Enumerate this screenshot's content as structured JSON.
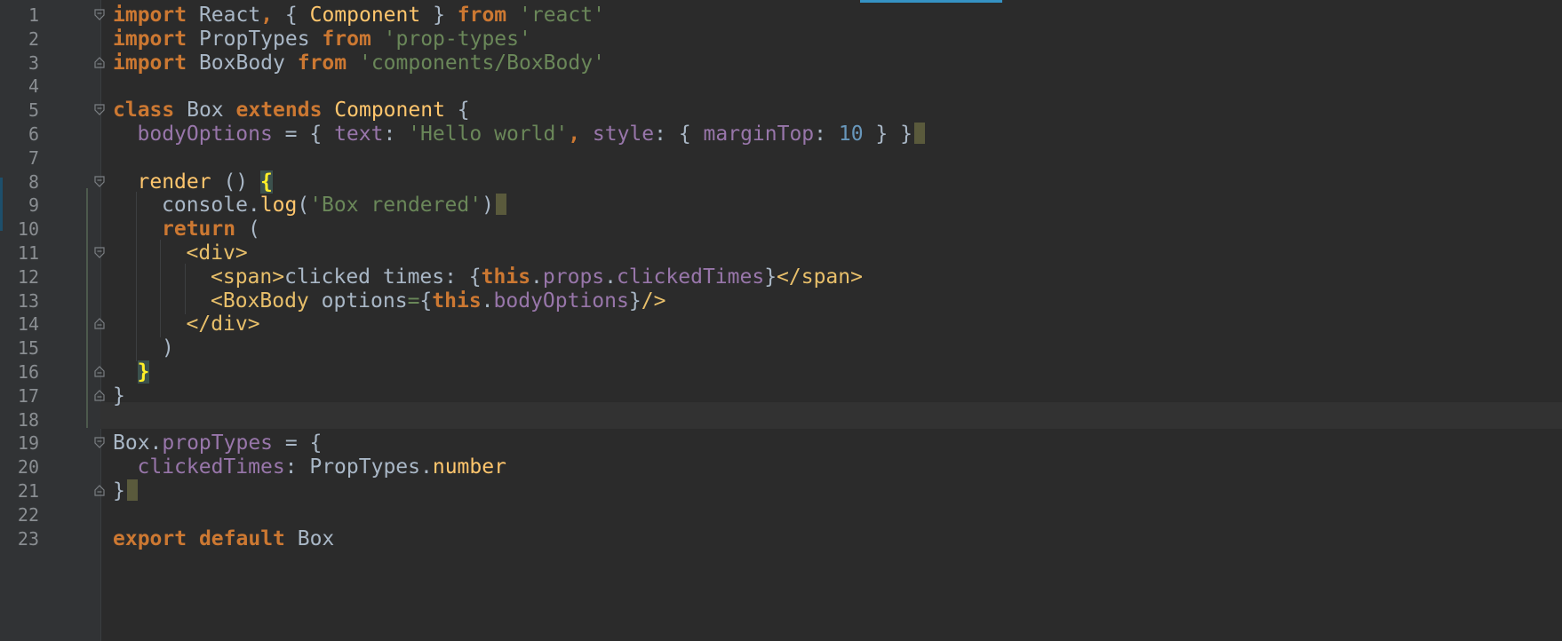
{
  "editor": {
    "lines": [
      {
        "n": "1",
        "fold": "open",
        "indent": 0,
        "tokens": [
          {
            "t": "import",
            "c": "kw"
          },
          {
            "t": " React",
            "c": "plain"
          },
          {
            "t": ",",
            "c": "kw"
          },
          {
            "t": " { ",
            "c": "plain"
          },
          {
            "t": "Component",
            "c": "cls"
          },
          {
            "t": " } ",
            "c": "plain"
          },
          {
            "t": "from",
            "c": "kw"
          },
          {
            "t": " ",
            "c": "plain"
          },
          {
            "t": "'react'",
            "c": "str"
          }
        ]
      },
      {
        "n": "2",
        "fold": "",
        "indent": 0,
        "tokens": [
          {
            "t": "import",
            "c": "kw"
          },
          {
            "t": " PropTypes ",
            "c": "plain"
          },
          {
            "t": "from",
            "c": "kw"
          },
          {
            "t": " ",
            "c": "plain"
          },
          {
            "t": "'prop-types'",
            "c": "str"
          }
        ]
      },
      {
        "n": "3",
        "fold": "close",
        "indent": 0,
        "tokens": [
          {
            "t": "import",
            "c": "kw"
          },
          {
            "t": " BoxBody ",
            "c": "plain"
          },
          {
            "t": "from",
            "c": "kw"
          },
          {
            "t": " ",
            "c": "plain"
          },
          {
            "t": "'components/BoxBody'",
            "c": "str"
          }
        ]
      },
      {
        "n": "4",
        "fold": "",
        "indent": 0,
        "tokens": []
      },
      {
        "n": "5",
        "fold": "open",
        "indent": 0,
        "tokens": [
          {
            "t": "class",
            "c": "kw"
          },
          {
            "t": " Box ",
            "c": "plain"
          },
          {
            "t": "extends",
            "c": "kw"
          },
          {
            "t": " ",
            "c": "plain"
          },
          {
            "t": "Component",
            "c": "cls"
          },
          {
            "t": " {",
            "c": "plain"
          }
        ]
      },
      {
        "n": "6",
        "fold": "",
        "indent": 1,
        "eol": true,
        "tokens": [
          {
            "t": "bodyOptions",
            "c": "prop"
          },
          {
            "t": " = { ",
            "c": "plain"
          },
          {
            "t": "text",
            "c": "prop"
          },
          {
            "t": ": ",
            "c": "plain"
          },
          {
            "t": "'Hello world'",
            "c": "str"
          },
          {
            "t": ", ",
            "c": "kw"
          },
          {
            "t": "style",
            "c": "prop"
          },
          {
            "t": ": { ",
            "c": "plain"
          },
          {
            "t": "marginTop",
            "c": "prop"
          },
          {
            "t": ": ",
            "c": "plain"
          },
          {
            "t": "10",
            "c": "num"
          },
          {
            "t": " } }",
            "c": "plain"
          }
        ]
      },
      {
        "n": "7",
        "fold": "",
        "indent": 0,
        "tokens": []
      },
      {
        "n": "8",
        "fold": "open",
        "indent": 1,
        "tokens": [
          {
            "t": "render",
            "c": "cls"
          },
          {
            "t": " () ",
            "c": "plain"
          },
          {
            "t": "{",
            "c": "brace-hl"
          }
        ]
      },
      {
        "n": "9",
        "fold": "",
        "indent": 2,
        "eol": true,
        "tokens": [
          {
            "t": "console.",
            "c": "plain"
          },
          {
            "t": "log",
            "c": "cls"
          },
          {
            "t": "(",
            "c": "plain"
          },
          {
            "t": "'Box rendered'",
            "c": "str"
          },
          {
            "t": ")",
            "c": "plain"
          }
        ]
      },
      {
        "n": "10",
        "fold": "",
        "indent": 2,
        "tokens": [
          {
            "t": "return",
            "c": "kw"
          },
          {
            "t": " (",
            "c": "plain"
          }
        ]
      },
      {
        "n": "11",
        "fold": "open",
        "indent": 3,
        "tokens": [
          {
            "t": "<div>",
            "c": "tag"
          }
        ]
      },
      {
        "n": "12",
        "fold": "",
        "indent": 4,
        "tokens": [
          {
            "t": "<span>",
            "c": "tag"
          },
          {
            "t": "clicked times: {",
            "c": "plain"
          },
          {
            "t": "this",
            "c": "kw"
          },
          {
            "t": ".",
            "c": "plain"
          },
          {
            "t": "props",
            "c": "prop"
          },
          {
            "t": ".",
            "c": "plain"
          },
          {
            "t": "clickedTimes",
            "c": "prop"
          },
          {
            "t": "}",
            "c": "plain"
          },
          {
            "t": "</span>",
            "c": "tag"
          }
        ]
      },
      {
        "n": "13",
        "fold": "",
        "indent": 4,
        "tokens": [
          {
            "t": "<BoxBody",
            "c": "tag"
          },
          {
            "t": " options",
            "c": "plain"
          },
          {
            "t": "=",
            "c": "str"
          },
          {
            "t": "{",
            "c": "plain"
          },
          {
            "t": "this",
            "c": "kw"
          },
          {
            "t": ".",
            "c": "plain"
          },
          {
            "t": "bodyOptions",
            "c": "prop"
          },
          {
            "t": "}",
            "c": "plain"
          },
          {
            "t": "/>",
            "c": "tag"
          }
        ]
      },
      {
        "n": "14",
        "fold": "close",
        "indent": 3,
        "tokens": [
          {
            "t": "</div>",
            "c": "tag"
          }
        ]
      },
      {
        "n": "15",
        "fold": "",
        "indent": 2,
        "tokens": [
          {
            "t": ")",
            "c": "plain"
          }
        ]
      },
      {
        "n": "16",
        "fold": "close",
        "indent": 1,
        "tokens": [
          {
            "t": "}",
            "c": "brace-hl"
          }
        ]
      },
      {
        "n": "17",
        "fold": "close",
        "indent": 0,
        "tokens": [
          {
            "t": "}",
            "c": "plain"
          }
        ]
      },
      {
        "n": "18",
        "fold": "",
        "indent": 0,
        "tokens": []
      },
      {
        "n": "19",
        "fold": "open",
        "indent": 0,
        "tokens": [
          {
            "t": "Box.",
            "c": "plain"
          },
          {
            "t": "propTypes",
            "c": "prop"
          },
          {
            "t": " = {",
            "c": "plain"
          }
        ]
      },
      {
        "n": "20",
        "fold": "",
        "indent": 1,
        "tokens": [
          {
            "t": "clickedTimes",
            "c": "prop"
          },
          {
            "t": ": PropTypes.",
            "c": "plain"
          },
          {
            "t": "number",
            "c": "cls"
          }
        ]
      },
      {
        "n": "21",
        "fold": "close",
        "indent": 0,
        "eol": true,
        "tokens": [
          {
            "t": "}",
            "c": "plain"
          }
        ]
      },
      {
        "n": "22",
        "fold": "",
        "indent": 0,
        "tokens": []
      },
      {
        "n": "23",
        "fold": "",
        "indent": 0,
        "tokens": [
          {
            "t": "export",
            "c": "kw"
          },
          {
            "t": " ",
            "c": "plain"
          },
          {
            "t": "default",
            "c": "kw"
          },
          {
            "t": " Box",
            "c": "plain"
          }
        ]
      }
    ]
  },
  "colors": {
    "background": "#2b2b2b",
    "keyword": "#cc7832",
    "string": "#6a8759",
    "number": "#6897bb",
    "property": "#9876aa",
    "function": "#ffc66d",
    "tag": "#e8bf6a",
    "text": "#a9b7c6"
  }
}
